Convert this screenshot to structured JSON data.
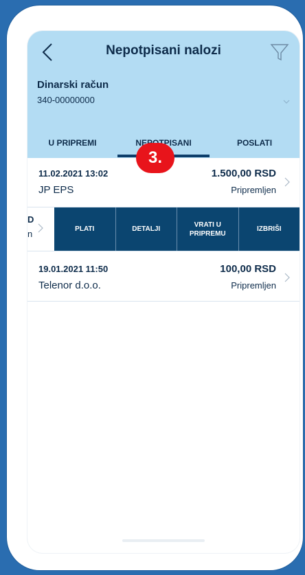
{
  "header": {
    "title": "Nepotpisani nalozi",
    "account_name": "Dinarski račun",
    "account_number": "340-00000000",
    "accent_color": "#b3dcf3"
  },
  "tabs": [
    {
      "label": "U PRIPREMI",
      "active": false
    },
    {
      "label": "NEPOTPISANI",
      "active": true
    },
    {
      "label": "POSLATI",
      "active": false
    }
  ],
  "orders": [
    {
      "date": "11.02.2021 13:02",
      "payee": "JP EPS",
      "amount": "1.500,00 RSD",
      "status": "Pripremljen"
    },
    {
      "date": "19.01.2021 11:50",
      "payee": "Telenor d.o.o.",
      "amount": "100,00 RSD",
      "status": "Pripremljen"
    }
  ],
  "swipe_peek": {
    "label": "D",
    "sub": "n"
  },
  "actions": [
    "PLATI",
    "DETALJI",
    "VRATI U PRIPREMU",
    "IZBRIŠI"
  ],
  "step_badge": "3.",
  "icons": [
    "back-arrow-icon",
    "filter-icon",
    "chevron-down-icon",
    "chevron-right-icon"
  ]
}
